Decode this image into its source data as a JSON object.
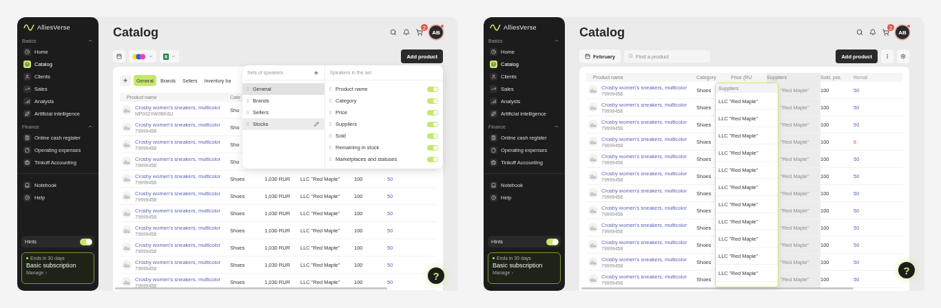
{
  "screens": [
    {
      "sidebar": {
        "logo": "AlliesVerse",
        "sections": [
          {
            "title": "Basics",
            "expanded": true,
            "items": [
              {
                "label": "Home",
                "selected": false
              },
              {
                "label": "Catalog",
                "selected": true
              },
              {
                "label": "Clients",
                "selected": false
              },
              {
                "label": "Sales",
                "selected": false
              },
              {
                "label": "Analysts",
                "selected": false
              },
              {
                "label": "Artificial intelligence",
                "selected": false
              }
            ]
          },
          {
            "title": "Finance",
            "expanded": true,
            "items": [
              {
                "label": "Online cash register",
                "selected": false
              },
              {
                "label": "Operating expenses",
                "selected": false
              },
              {
                "label": "Tinkoff Accounting",
                "selected": false
              }
            ]
          }
        ],
        "extra_items": [
          {
            "label": "Notebook",
            "selected": false
          },
          {
            "label": "Help",
            "selected": false
          }
        ],
        "hints": {
          "label": "Hints",
          "on": true
        },
        "subscription": {
          "note": "Ends in 30 days",
          "title": "Basic subscription",
          "link": "Manage"
        }
      },
      "header": {
        "title": "Catalog",
        "cart_count": "2",
        "avatar": {
          "initials": "AB",
          "alert": true
        }
      },
      "toolbar": {
        "left": [
          {
            "kind": "date"
          },
          {
            "kind": "marketplaces"
          },
          {
            "kind": "export"
          }
        ],
        "right": [
          {
            "kind": "primary",
            "label": "Add product"
          }
        ]
      },
      "tabs": [
        {
          "label": "General",
          "selected": true
        },
        {
          "label": "Brands",
          "selected": false
        },
        {
          "label": "Sellers",
          "selected": false
        },
        {
          "label": "Inventory ba",
          "selected": false
        }
      ],
      "table": {
        "columns": [
          {
            "label": "Product name",
            "dragging": false
          },
          {
            "label": "Cate",
            "dragging": false
          }
        ],
        "rows": [
          {
            "product": "Crosby women's sneakers, multicolor",
            "sku": "MP002XW0BK6U",
            "category": "Sho"
          },
          {
            "product": "Crosby women's sneakers, multicolor",
            "sku": "79999458",
            "category": "Sho"
          },
          {
            "product": "Crosby women's sneakers, multicolor",
            "sku": "79999458",
            "category": "Sho"
          },
          {
            "product": "Crosby women's sneakers, multicolor",
            "sku": "79999458",
            "category": "Sho"
          },
          {
            "product": "Crosby women's sneakers, multicolor",
            "sku": "79999458",
            "category": "Shoes",
            "price": "1,030 RUR",
            "supplier": "LLC \"Red Maple\"",
            "sold": "100",
            "remaining": "50",
            "low": false
          },
          {
            "product": "Crosby women's sneakers, multicolor",
            "sku": "79999458",
            "category": "Shoes",
            "price": "1,030 RUR",
            "supplier": "LLC \"Red Maple\"",
            "sold": "100",
            "remaining": "50",
            "low": false
          },
          {
            "product": "Crosby women's sneakers, multicolor",
            "sku": "79999458",
            "category": "Shoes",
            "price": "1,030 RUR",
            "supplier": "LLC \"Red Maple\"",
            "sold": "100",
            "remaining": "50",
            "low": false
          },
          {
            "product": "Crosby women's sneakers, multicolor",
            "sku": "79999458",
            "category": "Shoes",
            "price": "1,030 RUR",
            "supplier": "LLC \"Red Maple\"",
            "sold": "100",
            "remaining": "50",
            "low": false
          },
          {
            "product": "Crosby women's sneakers, multicolor",
            "sku": "79999458",
            "category": "Shoes",
            "price": "1,030 RUR",
            "supplier": "LLC \"Red Maple\"",
            "sold": "100",
            "remaining": "50",
            "low": false
          },
          {
            "product": "Crosby women's sneakers, multicolor",
            "sku": "79999458",
            "category": "Shoes",
            "price": "1,030 RUR",
            "supplier": "LLC \"Red Maple\"",
            "sold": "100",
            "remaining": "50",
            "low": false
          },
          {
            "product": "Crosby women's sneakers, multicolor",
            "sku": "79999458",
            "category": "Shoes",
            "price": "1,030 RUR",
            "supplier": "LLC \"Red Maple\"",
            "sold": "100",
            "remaining": "50",
            "low": false
          }
        ]
      },
      "column_sets": {
        "sets_title": "Sets of speakers",
        "sets": [
          {
            "label": "General",
            "selected": true,
            "hovered": false
          },
          {
            "label": "Brands",
            "selected": false,
            "hovered": false
          },
          {
            "label": "Sellers",
            "selected": false,
            "hovered": false
          },
          {
            "label": "Stocks",
            "selected": false,
            "hovered": true
          }
        ],
        "columns_title": "Speakers in the set",
        "columns": [
          {
            "label": "Product name",
            "on": true
          },
          {
            "label": "Category",
            "on": true
          },
          {
            "label": "Price",
            "on": true
          },
          {
            "label": "Suppliers",
            "on": true
          },
          {
            "label": "Sold",
            "on": true
          },
          {
            "label": "Remaining in stock",
            "on": true
          },
          {
            "label": "Marketplaces and statuses",
            "on": true
          }
        ]
      },
      "help_button": "?"
    },
    {
      "sidebar": {
        "logo": "AlliesVerse",
        "sections": [
          {
            "title": "Basics",
            "expanded": true,
            "items": [
              {
                "label": "Home",
                "selected": false
              },
              {
                "label": "Catalog",
                "selected": true
              },
              {
                "label": "Clients",
                "selected": false
              },
              {
                "label": "Sales",
                "selected": false
              },
              {
                "label": "Analysts",
                "selected": false
              },
              {
                "label": "Artificial intelligence",
                "selected": false
              }
            ]
          },
          {
            "title": "Finance",
            "expanded": true,
            "items": [
              {
                "label": "Online cash register",
                "selected": false
              },
              {
                "label": "Operating expenses",
                "selected": false
              },
              {
                "label": "Tinkoff Accounting",
                "selected": false
              }
            ]
          }
        ],
        "extra_items": [
          {
            "label": "Notebook",
            "selected": false
          },
          {
            "label": "Help",
            "selected": false
          }
        ],
        "hints": {
          "label": "Hints",
          "on": true
        },
        "subscription": {
          "note": "Ends in 30 days",
          "title": "Basic subscription",
          "link": "Manage"
        }
      },
      "header": {
        "title": "Catalog",
        "cart_count": "2",
        "avatar": {
          "initials": "AB",
          "alert": true
        }
      },
      "toolbar": {
        "left": [
          {
            "kind": "date",
            "label": "February"
          },
          {
            "kind": "search",
            "placeholder": "Find a product"
          }
        ],
        "right": [
          {
            "kind": "primary",
            "label": "Add product"
          },
          {
            "kind": "more"
          },
          {
            "kind": "settings"
          }
        ]
      },
      "table": {
        "columns": [
          {
            "label": "Product name",
            "dragging": false
          },
          {
            "label": "Category",
            "dragging": false
          },
          {
            "label": "Price (RU",
            "dragging": false
          },
          {
            "label": "Suppliers",
            "dragging": true
          },
          {
            "label": "Sold, pcs.",
            "dragging": false
          },
          {
            "label": "Remai",
            "dragging": false
          }
        ],
        "rows": [
          {
            "product": "Crosby women's sneakers, multicolor",
            "sku": "79999458",
            "category": "Shoes",
            "supplier": "\"Red Maple\"",
            "sold": "100",
            "remaining": "50",
            "low": false
          },
          {
            "product": "Crosby women's sneakers, multicolor",
            "sku": "79999458",
            "category": "Shoes",
            "supplier": "\"Red Maple\"",
            "sold": "100",
            "remaining": "50",
            "low": false
          },
          {
            "product": "Crosby women's sneakers, multicolor",
            "sku": "79999458",
            "category": "Shoes",
            "supplier": "\"Red Maple\"",
            "sold": "100",
            "remaining": "50",
            "low": false
          },
          {
            "product": "Crosby women's sneakers, multicolor",
            "sku": "79999458",
            "category": "Shoes",
            "supplier": "\"Red Maple\"",
            "sold": "100",
            "remaining": "8",
            "low": true
          },
          {
            "product": "Crosby women's sneakers, multicolor",
            "sku": "79999458",
            "category": "Shoes",
            "supplier": "\"Red Maple\"",
            "sold": "100",
            "remaining": "50",
            "low": false
          },
          {
            "product": "Crosby women's sneakers, multicolor",
            "sku": "79999458",
            "category": "Shoes",
            "supplier": "\"Red Maple\"",
            "sold": "100",
            "remaining": "50",
            "low": false
          },
          {
            "product": "Crosby women's sneakers, multicolor",
            "sku": "79999458",
            "category": "Shoes",
            "supplier": "\"Red Maple\"",
            "sold": "100",
            "remaining": "50",
            "low": false
          },
          {
            "product": "Crosby women's sneakers, multicolor",
            "sku": "79999458",
            "category": "Shoes",
            "supplier": "\"Red Maple\"",
            "sold": "100",
            "remaining": "50",
            "low": false
          },
          {
            "product": "Crosby women's sneakers, multicolor",
            "sku": "79999458",
            "category": "Shoes",
            "supplier": "\"Red Maple\"",
            "sold": "100",
            "remaining": "50",
            "low": false
          },
          {
            "product": "Crosby women's sneakers, multicolor",
            "sku": "79999458",
            "category": "Shoes",
            "supplier": "\"Red Maple\"",
            "sold": "100",
            "remaining": "50",
            "low": false
          },
          {
            "product": "Crosby women's sneakers, multicolor",
            "sku": "79999458",
            "category": "Shoes",
            "supplier": "\"Red Maple\"",
            "sold": "100",
            "remaining": "50",
            "low": false
          },
          {
            "product": "Crosby women's sneakers, multicolor",
            "sku": "79999458",
            "category": "Shoes",
            "supplier": "\"Red Maple\"",
            "sold": "100",
            "remaining": "50",
            "low": false
          }
        ]
      },
      "dragged_column": {
        "label": "Suppliers",
        "cells": [
          "LLC \"Red Maple\"",
          "LLC \"Red Maple\"",
          "LLC \"Red Maple\"",
          "LLC \"Red Maple\"",
          "LLC \"Red Maple\"",
          "LLC \"Red Maple\"",
          "LLC \"Red Maple\"",
          "LLC \"Red Maple\"",
          "LLC \"Red Maple\"",
          "LLC \"Red Maple\"",
          "LLC \"Red Maple\""
        ]
      },
      "help_button": "?"
    }
  ]
}
